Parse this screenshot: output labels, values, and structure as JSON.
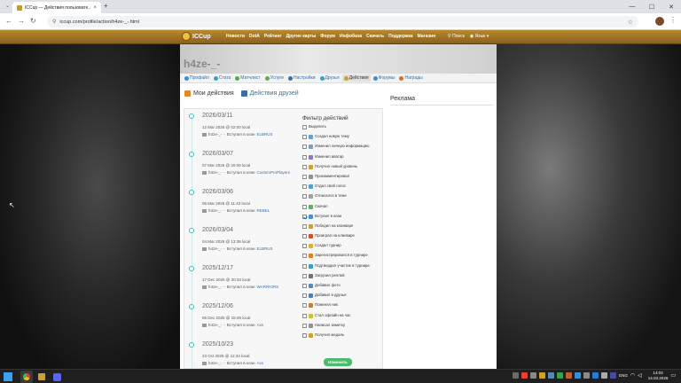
{
  "browser": {
    "tab_title": "ICCup — Действия пользовате...",
    "url": "iccup.com/profile/action/h4ze-_-.html",
    "new_tab": "+",
    "close_tab": "×",
    "win_min": "—",
    "win_max": "☐",
    "win_close": "✕"
  },
  "site": {
    "logo": "ICCup",
    "menu": [
      "Новости",
      "DotA",
      "Рейтинг",
      "Другие карты",
      "Форум",
      "Инфобаза",
      "Скачать",
      "Поддержка",
      "Магазин"
    ],
    "search": "Поиск",
    "lang": "Язык"
  },
  "profile": {
    "username": "h4ze-_-",
    "subnav": [
      {
        "label": "Профайл",
        "color": "#3a8fd0"
      },
      {
        "label": "Стата",
        "color": "#3aa0c0"
      },
      {
        "label": "Матчлист",
        "color": "#4cae4c"
      },
      {
        "label": "Услуги",
        "color": "#6aa84f"
      },
      {
        "label": "Настройки",
        "color": "#3a6ea5"
      },
      {
        "label": "Друзья",
        "color": "#3aa0c0"
      },
      {
        "label": "Действия",
        "color": "#c9a13a"
      },
      {
        "label": "Форумы",
        "color": "#3a8fd0"
      },
      {
        "label": "Награды",
        "color": "#d07030"
      }
    ]
  },
  "activity_tabs": {
    "mine": "Мои действия",
    "friends": "Действия друзей"
  },
  "timeline": [
    {
      "date": "2026/03/11",
      "time": "12 Mar 2026 @ 02:00 local",
      "user": "h4ze-_-",
      "action": "Вступил в клан",
      "clan": "ELBRUS"
    },
    {
      "date": "2026/03/07",
      "time": "07 Mar 2026 @ 20:09 local",
      "user": "h4ze-_-",
      "action": "Вступил в клан",
      "clan": "CustomProPlayers"
    },
    {
      "date": "2026/03/06",
      "time": "06 Mar 2026 @ 11:43 local",
      "user": "h4ze-_-",
      "action": "Вступил в клан",
      "clan": "REBEL"
    },
    {
      "date": "2026/03/04",
      "time": "04 Mar 2026 @ 13:39 local",
      "user": "h4ze-_-",
      "action": "Вступил в клан",
      "clan": "ELBRUS"
    },
    {
      "date": "2025/12/17",
      "time": "17 Dec 2025 @ 20:33 local",
      "user": "h4ze-_-",
      "action": "Вступил в клан",
      "clan": "WARRIORS"
    },
    {
      "date": "2025/12/06",
      "time": "06 Dec 2025 @ 18:49 local",
      "user": "h4ze-_-",
      "action": "Вступил в клан",
      "clan": "Axs"
    },
    {
      "date": "2025/10/23",
      "time": "23 Oct 2025 @ 12:34 local",
      "user": "h4ze-_-",
      "action": "Вступил в клан",
      "clan": "Axs"
    }
  ],
  "filter": {
    "title": "Фильтр действий",
    "select_all": "Выделить",
    "items": [
      {
        "label": "Создал новую тему",
        "checked": false,
        "color": "#6aa0d0"
      },
      {
        "label": "Изменил личную информацию",
        "checked": false,
        "color": "#7a9ec0"
      },
      {
        "label": "Изменил аватар",
        "checked": false,
        "color": "#8a7ac0"
      },
      {
        "label": "Получил новый уровень",
        "checked": false,
        "color": "#d0a030"
      },
      {
        "label": "Прокомментировал",
        "checked": false,
        "color": "#909090"
      },
      {
        "label": "Отдал свой голос",
        "checked": false,
        "color": "#50a0d0"
      },
      {
        "label": "Отписался в теме",
        "checked": false,
        "color": "#a0a0a0"
      },
      {
        "label": "Скачал",
        "checked": false,
        "color": "#60b060"
      },
      {
        "label": "Вступил в клан",
        "checked": true,
        "color": "#4a90d0"
      },
      {
        "label": "Победил на кланваре",
        "checked": false,
        "color": "#d0a030"
      },
      {
        "label": "Проиграл на кланваре",
        "checked": false,
        "color": "#d05030"
      },
      {
        "label": "Создал турнир",
        "checked": false,
        "color": "#e0b020"
      },
      {
        "label": "Зарегистрировался в турнире",
        "checked": false,
        "color": "#e08020"
      },
      {
        "label": "Подтвердил участие в турнире",
        "checked": false,
        "color": "#3aa0c0"
      },
      {
        "label": "Загрузил реплей",
        "checked": false,
        "color": "#707070"
      },
      {
        "label": "Добавил фото",
        "checked": false,
        "color": "#5a8ab0"
      },
      {
        "label": "Добавил в друзья",
        "checked": false,
        "color": "#4a80c0"
      },
      {
        "label": "Поменял ник",
        "checked": false,
        "color": "#c08040"
      },
      {
        "label": "Стал офлайн на час",
        "checked": false,
        "color": "#d0c030"
      },
      {
        "label": "Написал заметку",
        "checked": false,
        "color": "#9090a0"
      },
      {
        "label": "Получил медаль",
        "checked": false,
        "color": "#d0a030"
      }
    ],
    "apply": "Изменить"
  },
  "sidebar": {
    "ads_title": "Реклама"
  },
  "taskbar": {
    "lang": "ENG",
    "time": "14:03",
    "date": "14.03.2026"
  }
}
